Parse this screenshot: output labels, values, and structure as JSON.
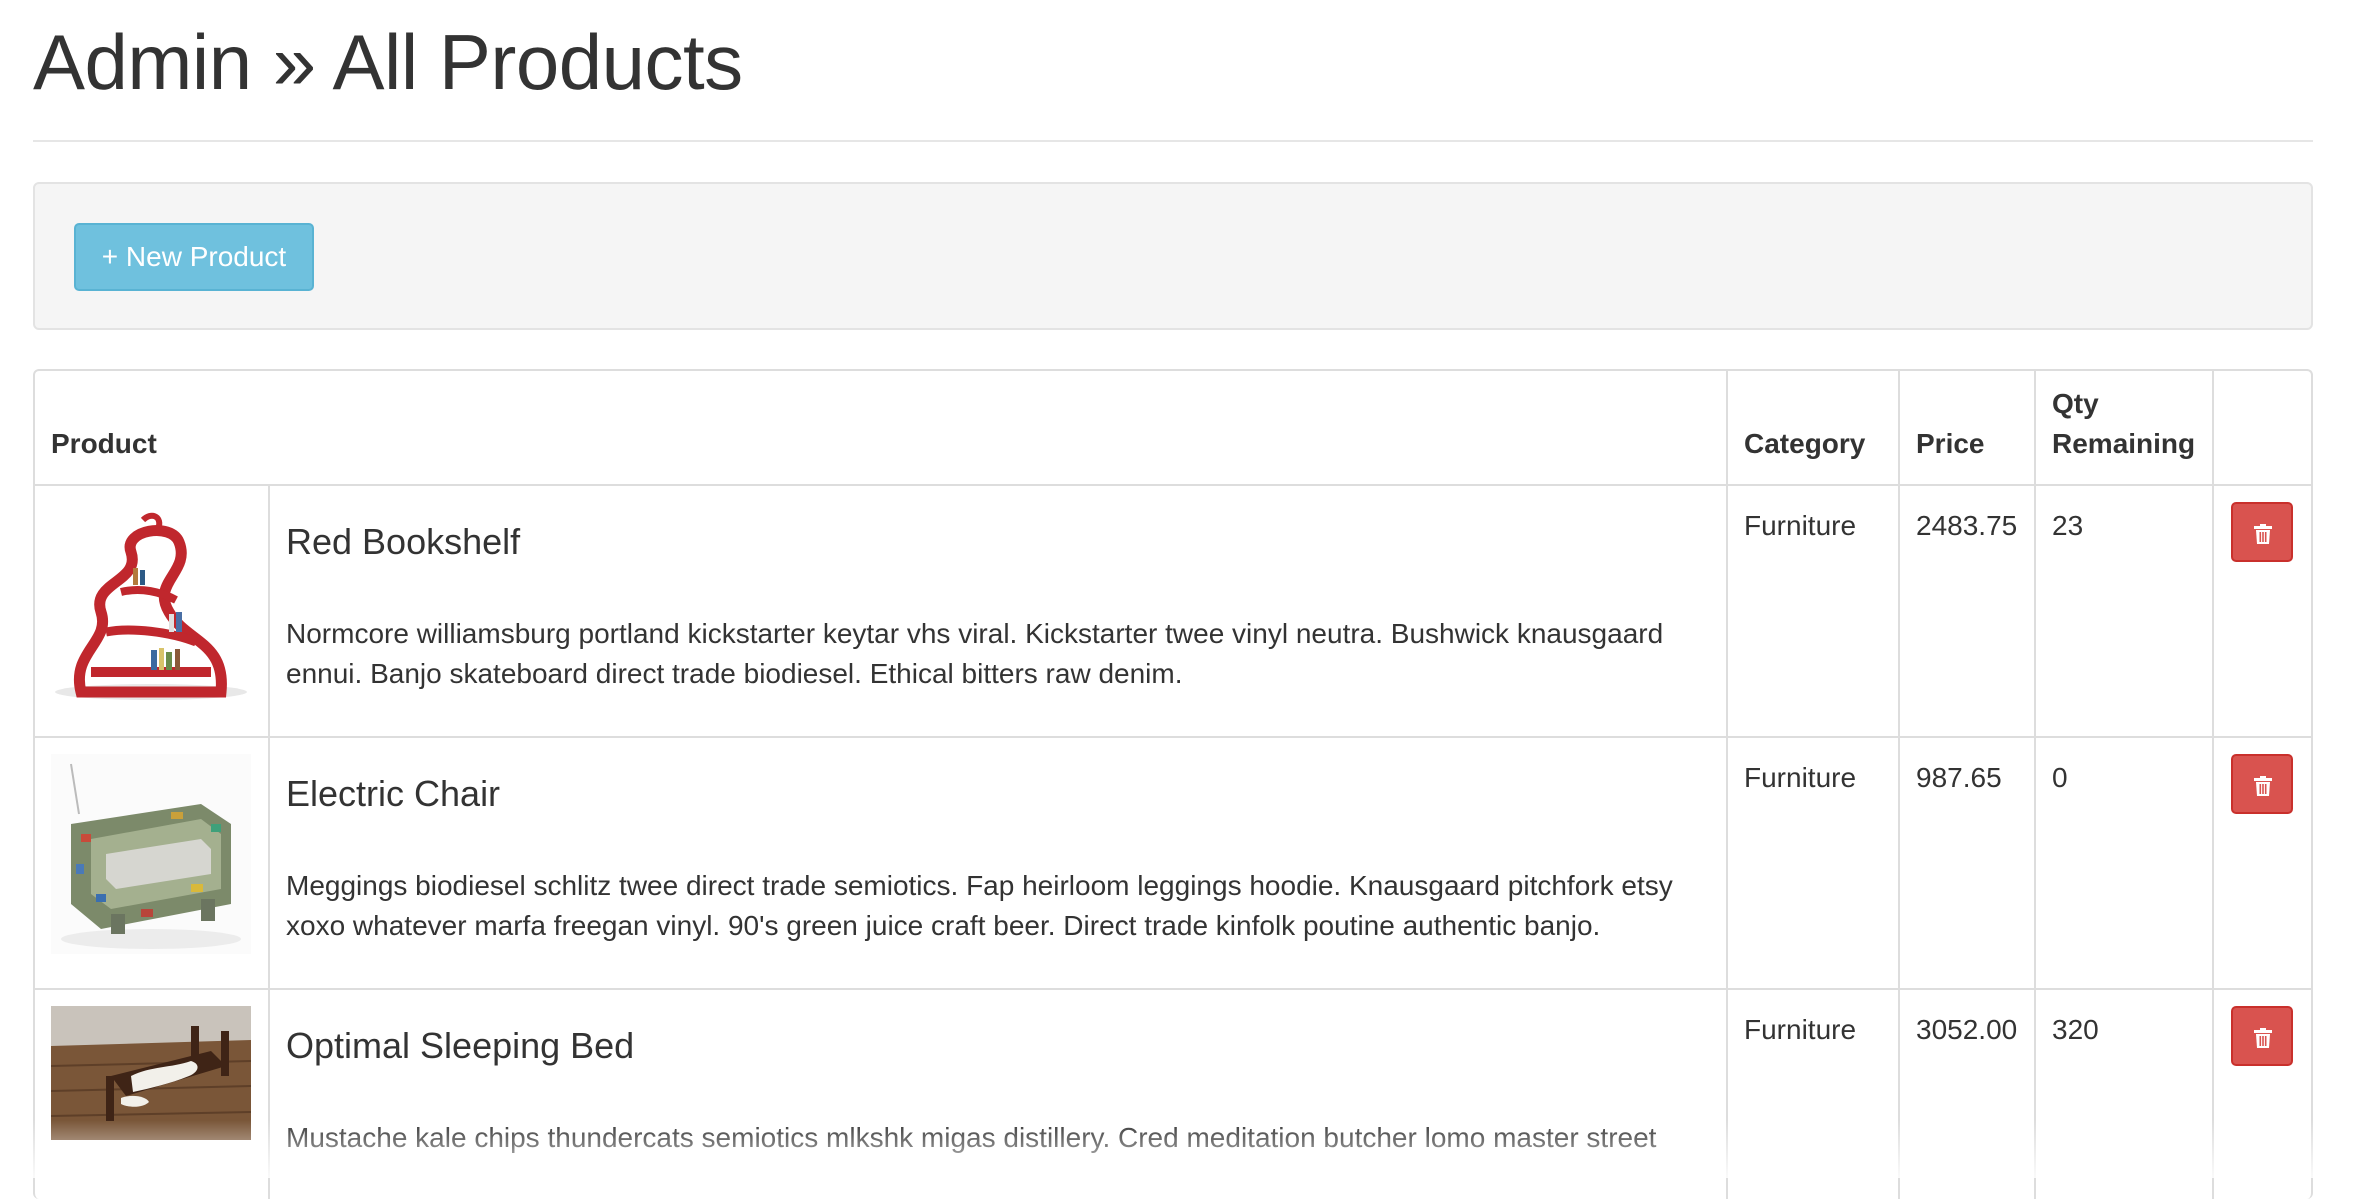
{
  "header": {
    "title": "Admin » All Products"
  },
  "toolbar": {
    "new_product_label": "+ New Product"
  },
  "table": {
    "columns": {
      "product": "Product",
      "category": "Category",
      "price": "Price",
      "qty_line1": "Qty",
      "qty_line2": "Remaining"
    },
    "rows": [
      {
        "name": "Red Bookshelf",
        "description": "Normcore williamsburg portland kickstarter keytar vhs viral. Kickstarter twee vinyl neutra. Bushwick knausgaard ennui. Banjo skateboard direct trade biodiesel. Ethical bitters raw denim.",
        "category": "Furniture",
        "price": "2483.75",
        "qty": "23",
        "image": "red-bookshelf-photo"
      },
      {
        "name": "Electric Chair",
        "description": "Meggings biodiesel schlitz twee direct trade semiotics. Fap heirloom leggings hoodie. Knausgaard pitchfork etsy xoxo whatever marfa freegan vinyl. 90's green juice craft beer. Direct trade kinfolk poutine authentic banjo.",
        "category": "Furniture",
        "price": "987.65",
        "qty": "0",
        "image": "circuit-board-chair-photo"
      },
      {
        "name": "Optimal Sleeping Bed",
        "description": "Mustache kale chips thundercats semiotics mlkshk migas distillery. Cred meditation butcher lomo master street",
        "category": "Furniture",
        "price": "3052.00",
        "qty": "320",
        "image": "sleeping-bed-photo"
      }
    ]
  },
  "icons": {
    "delete": "trash-icon"
  },
  "colors": {
    "new_button": "#6fc1de",
    "delete_button": "#d9534f"
  }
}
